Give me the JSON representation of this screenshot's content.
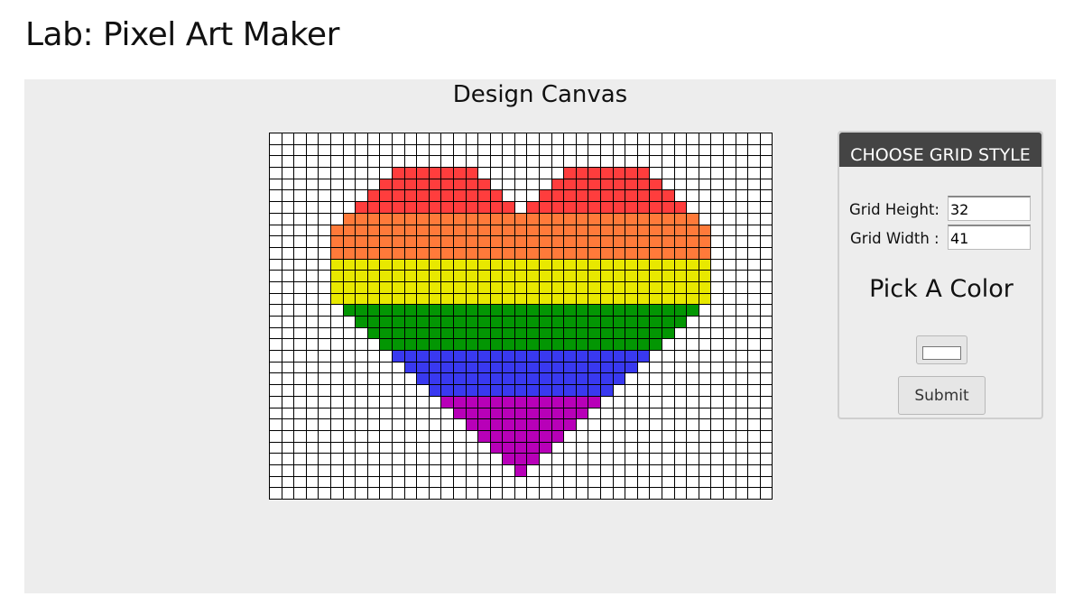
{
  "page": {
    "title": "Lab: Pixel Art Maker"
  },
  "canvas": {
    "title": "Design Canvas",
    "rows": 32,
    "cols": 41,
    "colors": {
      "red": "#ff3d3d",
      "orange": "#ff7a3a",
      "yellow": "#e8e800",
      "green": "#039603",
      "blue": "#3939f0",
      "purple": "#b800b8"
    },
    "painted": [
      {
        "row": 3,
        "spans": [
          [
            10,
            16
          ],
          [
            24,
            30
          ]
        ],
        "color": "red"
      },
      {
        "row": 4,
        "spans": [
          [
            9,
            17
          ],
          [
            23,
            31
          ]
        ],
        "color": "red"
      },
      {
        "row": 5,
        "spans": [
          [
            8,
            18
          ],
          [
            22,
            32
          ]
        ],
        "color": "red"
      },
      {
        "row": 6,
        "spans": [
          [
            7,
            19
          ],
          [
            21,
            33
          ]
        ],
        "color": "red"
      },
      {
        "row": 7,
        "spans": [
          [
            6,
            34
          ]
        ],
        "color": "orange"
      },
      {
        "row": 8,
        "spans": [
          [
            5,
            35
          ]
        ],
        "color": "orange"
      },
      {
        "row": 9,
        "spans": [
          [
            5,
            35
          ]
        ],
        "color": "orange"
      },
      {
        "row": 10,
        "spans": [
          [
            5,
            35
          ]
        ],
        "color": "orange"
      },
      {
        "row": 11,
        "spans": [
          [
            5,
            35
          ]
        ],
        "color": "yellow"
      },
      {
        "row": 12,
        "spans": [
          [
            5,
            35
          ]
        ],
        "color": "yellow"
      },
      {
        "row": 13,
        "spans": [
          [
            5,
            35
          ]
        ],
        "color": "yellow"
      },
      {
        "row": 14,
        "spans": [
          [
            5,
            35
          ]
        ],
        "color": "yellow"
      },
      {
        "row": 15,
        "spans": [
          [
            6,
            34
          ]
        ],
        "color": "green"
      },
      {
        "row": 16,
        "spans": [
          [
            7,
            33
          ]
        ],
        "color": "green"
      },
      {
        "row": 17,
        "spans": [
          [
            8,
            32
          ]
        ],
        "color": "green"
      },
      {
        "row": 18,
        "spans": [
          [
            9,
            31
          ]
        ],
        "color": "green"
      },
      {
        "row": 19,
        "spans": [
          [
            10,
            30
          ]
        ],
        "color": "blue"
      },
      {
        "row": 20,
        "spans": [
          [
            11,
            29
          ]
        ],
        "color": "blue"
      },
      {
        "row": 21,
        "spans": [
          [
            12,
            28
          ]
        ],
        "color": "blue"
      },
      {
        "row": 22,
        "spans": [
          [
            13,
            27
          ]
        ],
        "color": "blue"
      },
      {
        "row": 23,
        "spans": [
          [
            14,
            26
          ]
        ],
        "color": "purple"
      },
      {
        "row": 24,
        "spans": [
          [
            15,
            25
          ]
        ],
        "color": "purple"
      },
      {
        "row": 25,
        "spans": [
          [
            16,
            24
          ]
        ],
        "color": "purple"
      },
      {
        "row": 26,
        "spans": [
          [
            17,
            23
          ]
        ],
        "color": "purple"
      },
      {
        "row": 27,
        "spans": [
          [
            18,
            22
          ]
        ],
        "color": "purple"
      },
      {
        "row": 28,
        "spans": [
          [
            19,
            21
          ]
        ],
        "color": "purple"
      },
      {
        "row": 29,
        "spans": [
          [
            20,
            20
          ]
        ],
        "color": "purple"
      }
    ]
  },
  "panel": {
    "header": "CHOOSE GRID STYLE",
    "height_label": "Grid Height:",
    "height_value": "32",
    "width_label": "Grid Width :",
    "width_value": "41",
    "pick_color_label": "Pick A Color",
    "color_value": "#ffffff",
    "submit_label": "Submit"
  }
}
